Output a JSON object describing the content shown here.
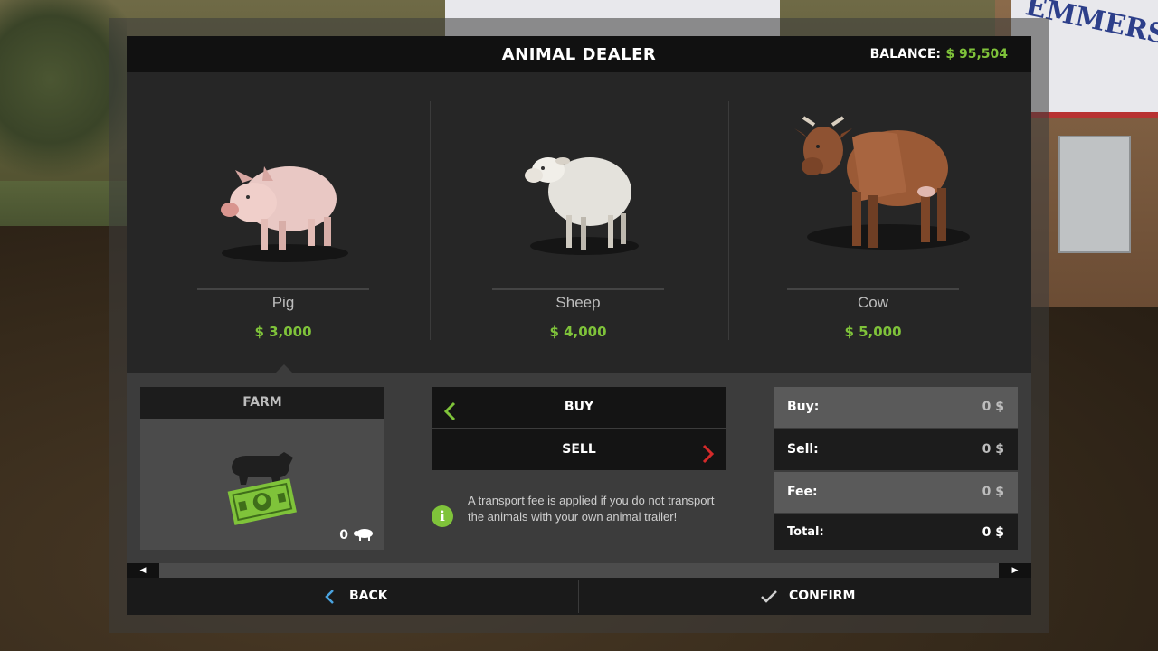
{
  "header": {
    "title": "ANIMAL DEALER",
    "balance_label": "BALANCE:",
    "balance_value": "$ 95,504"
  },
  "animals": [
    {
      "name": "Pig",
      "price": "$ 3,000",
      "icon": "pig-icon"
    },
    {
      "name": "Sheep",
      "price": "$ 4,000",
      "icon": "sheep-icon"
    },
    {
      "name": "Cow",
      "price": "$ 5,000",
      "icon": "cow-icon"
    }
  ],
  "farm": {
    "title": "FARM",
    "count": "0"
  },
  "trade": {
    "buy_label": "BUY",
    "sell_label": "SELL"
  },
  "info": {
    "text": "A transport fee is applied if you do not transport the animals with your own animal trailer!"
  },
  "summary": {
    "buy_label": "Buy:",
    "buy_value": "0 $",
    "sell_label": "Sell:",
    "sell_value": "0 $",
    "fee_label": "Fee:",
    "fee_value": "0 $",
    "total_label": "Total:",
    "total_value": "0 $"
  },
  "footer": {
    "back_label": "BACK",
    "confirm_label": "CONFIRM"
  },
  "colors": {
    "accent_green": "#7fc33a",
    "sell_arrow_red": "#d42a2a",
    "back_icon_blue": "#4aa3df"
  }
}
